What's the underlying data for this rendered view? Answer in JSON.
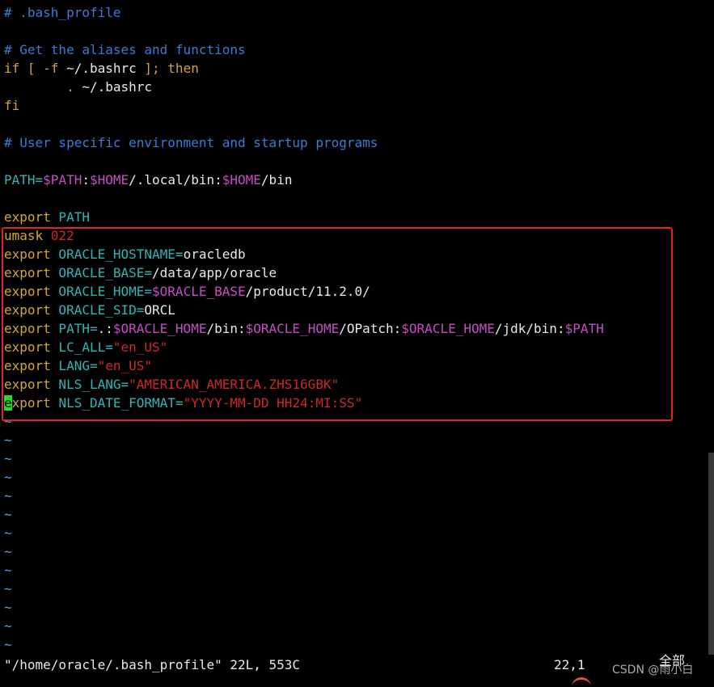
{
  "editor": {
    "lines": [
      [
        {
          "t": "# .bash_profile",
          "c": "comment"
        }
      ],
      [],
      [
        {
          "t": "# Get the aliases and functions",
          "c": "comment"
        }
      ],
      [
        {
          "t": "if [ -f ",
          "c": "keyword"
        },
        {
          "t": "~/.bashrc",
          "c": "plain"
        },
        {
          "t": " ]; then",
          "c": "keyword"
        }
      ],
      [
        {
          "t": "        . ",
          "c": "keyword"
        },
        {
          "t": "~/.bashrc",
          "c": "plain"
        }
      ],
      [
        {
          "t": "fi",
          "c": "keyword"
        }
      ],
      [],
      [
        {
          "t": "# User specific environment and startup programs",
          "c": "comment"
        }
      ],
      [],
      [
        {
          "t": "PATH=",
          "c": "ident"
        },
        {
          "t": "$PATH",
          "c": "var"
        },
        {
          "t": ":",
          "c": "plain"
        },
        {
          "t": "$HOME",
          "c": "var"
        },
        {
          "t": "/.local/bin:",
          "c": "plain"
        },
        {
          "t": "$HOME",
          "c": "var"
        },
        {
          "t": "/bin",
          "c": "plain"
        }
      ],
      [],
      [
        {
          "t": "export",
          "c": "keyword"
        },
        {
          "t": " PATH",
          "c": "ident"
        }
      ],
      [
        {
          "t": "umask",
          "c": "keyword"
        },
        {
          "t": " 022",
          "c": "number"
        }
      ],
      [
        {
          "t": "export",
          "c": "keyword"
        },
        {
          "t": " ORACLE_HOSTNAME=",
          "c": "ident"
        },
        {
          "t": "oracledb",
          "c": "plain"
        }
      ],
      [
        {
          "t": "export",
          "c": "keyword"
        },
        {
          "t": " ORACLE_BASE=",
          "c": "ident"
        },
        {
          "t": "/data/app/oracle",
          "c": "plain"
        }
      ],
      [
        {
          "t": "export",
          "c": "keyword"
        },
        {
          "t": " ORACLE_HOME=",
          "c": "ident"
        },
        {
          "t": "$ORACLE_BASE",
          "c": "var"
        },
        {
          "t": "/product/11.2.0/",
          "c": "plain"
        }
      ],
      [
        {
          "t": "export",
          "c": "keyword"
        },
        {
          "t": " ORACLE_SID=",
          "c": "ident"
        },
        {
          "t": "ORCL",
          "c": "plain"
        }
      ],
      [
        {
          "t": "export",
          "c": "keyword"
        },
        {
          "t": " PATH=",
          "c": "ident"
        },
        {
          "t": ".:",
          "c": "plain"
        },
        {
          "t": "$ORACLE_HOME",
          "c": "var"
        },
        {
          "t": "/bin:",
          "c": "plain"
        },
        {
          "t": "$ORACLE_HOME",
          "c": "var"
        },
        {
          "t": "/OPatch:",
          "c": "plain"
        },
        {
          "t": "$ORACLE_HOME",
          "c": "var"
        },
        {
          "t": "/jdk/bin:",
          "c": "plain"
        },
        {
          "t": "$PATH",
          "c": "var"
        }
      ],
      [
        {
          "t": "export",
          "c": "keyword"
        },
        {
          "t": " LC_ALL=",
          "c": "ident"
        },
        {
          "t": "\"en_US\"",
          "c": "string"
        }
      ],
      [
        {
          "t": "export",
          "c": "keyword"
        },
        {
          "t": " LANG=",
          "c": "ident"
        },
        {
          "t": "\"en_US\"",
          "c": "string"
        }
      ],
      [
        {
          "t": "export",
          "c": "keyword"
        },
        {
          "t": " NLS_LANG=",
          "c": "ident"
        },
        {
          "t": "\"AMERICAN_AMERICA.ZHS16GBK\"",
          "c": "string"
        }
      ],
      [
        {
          "t": "e",
          "c": "cursor"
        },
        {
          "t": "xport",
          "c": "keyword"
        },
        {
          "t": " NLS_DATE_FORMAT=",
          "c": "ident"
        },
        {
          "t": "\"YYYY-MM-DD HH24:MI:SS\"",
          "c": "string"
        }
      ]
    ],
    "empty_line_marker": "~",
    "empty_line_count": 13
  },
  "statusline": {
    "file_info": "\"/home/oracle/.bash_profile\" 22L, 553C",
    "cursor_position": "22,1",
    "scroll_position": "全部"
  },
  "watermark": "CSDN @雨小白",
  "colors": {
    "comment": "#3b7bd8",
    "keyword": "#d4a62a",
    "variable": "#c44dc4",
    "identifier": "#2fb5b5",
    "string": "#d02828",
    "highlight_box": "#e0242a",
    "cursor": "#22dd22",
    "tilde": "#5a9be8"
  }
}
